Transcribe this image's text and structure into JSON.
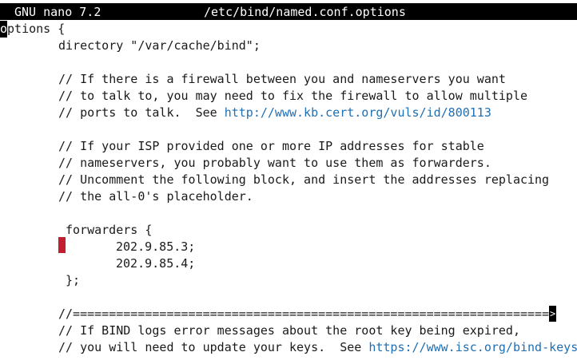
{
  "titlebar": {
    "app": "GNU nano 7.2",
    "filename": "/etc/bind/named.conf.options"
  },
  "editor": {
    "line1_cursor_char": "o",
    "line1_rest": "ptions {",
    "line2": "directory \"/var/cache/bind\";",
    "c1": "// If there is a firewall between you and nameservers you want",
    "c2": "// to talk to, you may need to fix the firewall to allow multiple",
    "c3_text": "// ports to talk.  See ",
    "c3_url": "http://www.kb.cert.org/vuls/id/800113",
    "c4": "// If your ISP provided one or more IP addresses for stable",
    "c5": "// nameservers, you probably want to use them as forwarders.",
    "c6": "// Uncomment the following block, and insert the addresses replacing",
    "c7": "// the all-0's placeholder.",
    "forwarders_open": "forwarders {",
    "ip1": "202.9.85.3;",
    "ip2": "202.9.85.4;",
    "forwarders_close": "};",
    "separator": "//==================================================================",
    "overflow_glyph": ">",
    "c8": "// If BIND logs error messages about the root key being expired,",
    "c9_text": "// you will need to update your keys.  See ",
    "c9_url": "https://www.isc.org/bind-keys"
  }
}
